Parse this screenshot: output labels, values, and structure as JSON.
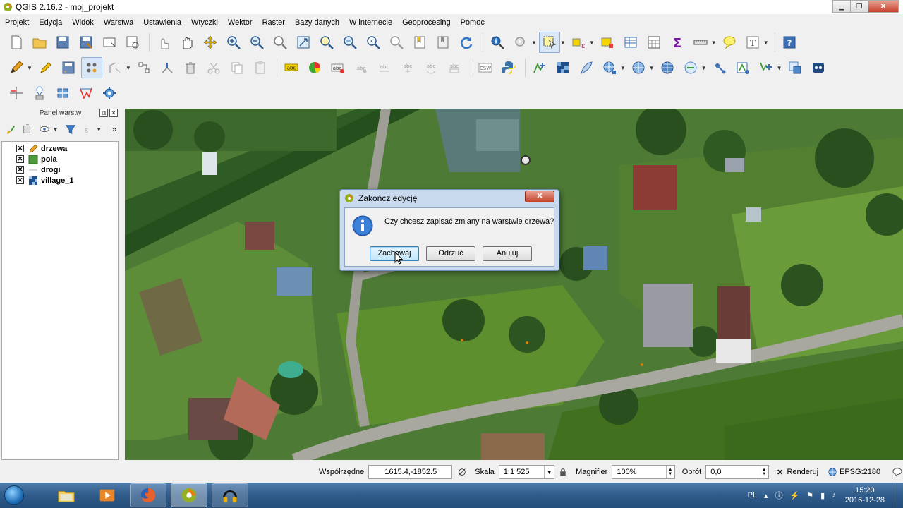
{
  "window": {
    "title": "QGIS 2.16.2 - moj_projekt",
    "controls": [
      "minimize",
      "maximize",
      "close"
    ]
  },
  "menu": [
    "Projekt",
    "Edycja",
    "Widok",
    "Warstwa",
    "Ustawienia",
    "Wtyczki",
    "Wektor",
    "Raster",
    "Bazy danych",
    "W internecie",
    "Geoprocesing",
    "Pomoc"
  ],
  "layers_panel": {
    "title": "Panel warstw",
    "layers": [
      {
        "name": "drzewa",
        "symbol": "pencil-edit",
        "checked": true,
        "selected": true
      },
      {
        "name": "pola",
        "symbol": "polygon-fill",
        "checked": true,
        "selected": false
      },
      {
        "name": "drogi",
        "symbol": "line",
        "checked": true,
        "selected": false
      },
      {
        "name": "village_1",
        "symbol": "raster",
        "checked": true,
        "selected": false
      }
    ]
  },
  "dialog": {
    "title": "Zakończ edycję",
    "message": "Czy chcesz zapisać zmiany na warstwie drzewa?",
    "buttons": {
      "save": "Zachowaj",
      "discard": "Odrzuć",
      "cancel": "Anuluj"
    },
    "close_symbol": "✕"
  },
  "statusbar": {
    "coord_label": "Współrzędne",
    "coord_value": "1615.4,-1852.5",
    "scale_label": "Skala",
    "scale_value": "1:1 525",
    "magnifier_label": "Magnifier",
    "magnifier_value": "100%",
    "rotation_label": "Obrót",
    "rotation_value": "0,0",
    "render_label": "Renderuj",
    "crs": "EPSG:2180"
  },
  "taskbar": {
    "language": "PL",
    "time": "15:20",
    "date": "2016-12-28"
  },
  "colors": {
    "accent": "#3c7fb1",
    "taskbar": "#2f5b8a",
    "dialog_frame": "#c9d9ee"
  }
}
